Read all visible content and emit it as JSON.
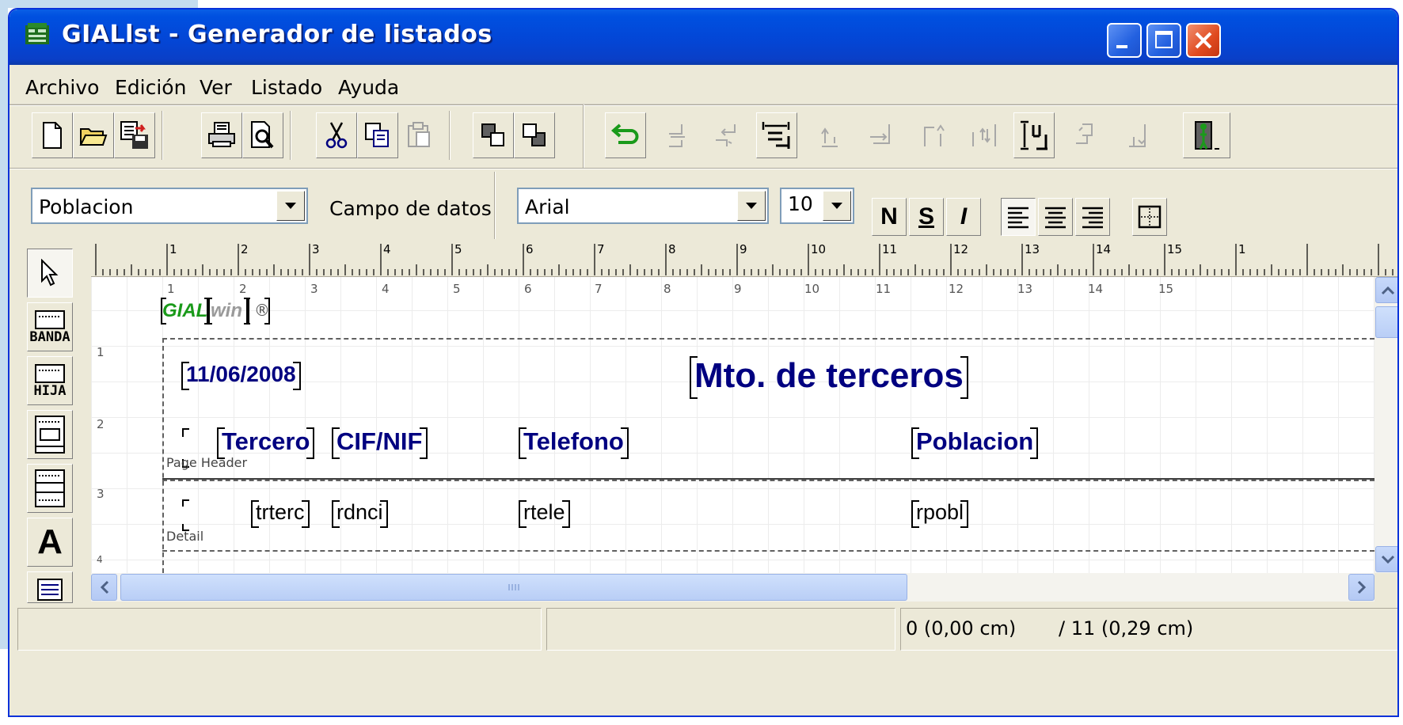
{
  "window": {
    "title": "GIALlst - Generador de listados"
  },
  "menu": [
    "Archivo",
    "Edición",
    "Ver",
    "Listado",
    "Ayuda"
  ],
  "format_bar": {
    "field_combo": "Poblacion",
    "field_label": "Campo de datos",
    "font_combo": "Arial",
    "size_combo": "10",
    "bold_label": "N",
    "underline_label": "S",
    "italic_label": "I"
  },
  "left_tools": {
    "banda_label": "BANDA",
    "hija_label": "HIJA",
    "text_tool_label": "A"
  },
  "ruler": [
    "1",
    "2",
    "3",
    "4",
    "5",
    "6",
    "7",
    "8",
    "9",
    "10",
    "11",
    "12",
    "13",
    "14",
    "15",
    "1"
  ],
  "canvas_cols": [
    "1",
    "2",
    "3",
    "4",
    "5",
    "6",
    "7",
    "8",
    "9",
    "10",
    "11",
    "12",
    "13",
    "14",
    "15"
  ],
  "canvas_rows": [
    "1",
    "2",
    "3",
    "4"
  ],
  "report": {
    "logo_green": "GIAL",
    "logo_gray": "win",
    "logo_reg": "®",
    "date": "11/06/2008",
    "title": "Mto. de terceros",
    "headers": [
      "Tercero",
      "CIF/NIF",
      "Telefono",
      "Poblacion"
    ],
    "page_header_label": "Page Header",
    "details": [
      "trterc",
      "rdnci",
      "rtele",
      "rpobl"
    ],
    "detail_label": "Detail"
  },
  "status": {
    "pos_x": "0 (0,00 cm)",
    "pos_y": "/ 11 (0,29 cm)"
  },
  "colors": {
    "title_bar": "#0346d6",
    "field_text": "#000080",
    "logo_green": "#1a9a1a"
  }
}
